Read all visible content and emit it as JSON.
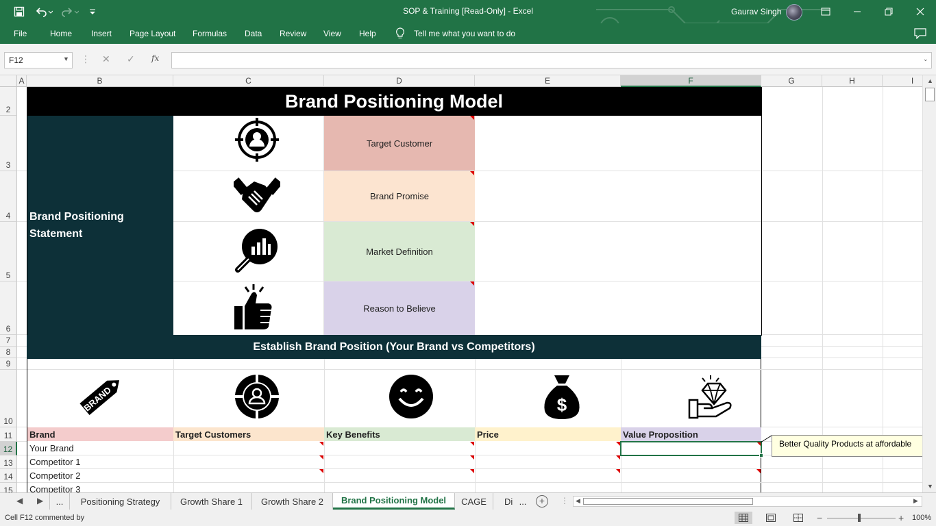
{
  "window": {
    "title": "SOP & Training  [Read-Only]  -  Excel",
    "user": "Gaurav Singh"
  },
  "ribbon": {
    "tabs": [
      "File",
      "Home",
      "Insert",
      "Page Layout",
      "Formulas",
      "Data",
      "Review",
      "View",
      "Help"
    ],
    "tell_me": "Tell me what you want to do"
  },
  "formula_bar": {
    "name_box": "F12",
    "fx": "fx",
    "formula": ""
  },
  "columns": [
    "A",
    "B",
    "C",
    "D",
    "E",
    "F",
    "G",
    "H",
    "I"
  ],
  "selected_column": "F",
  "rows": [
    "2",
    "3",
    "4",
    "5",
    "6",
    "7",
    "8",
    "9",
    "10",
    "11",
    "12",
    "13",
    "14",
    "15"
  ],
  "selected_row": "12",
  "sheet": {
    "title": "Brand Positioning Model",
    "statement_label": "Brand Positioning Statement",
    "elements": [
      "Target Customer",
      "Brand Promise",
      "Market Definition",
      "Reason to Believe"
    ],
    "establish_title": "Establish Brand Position (Your Brand vs Competitors)",
    "brand_icon_text": "BRAND",
    "table_headers": [
      "Brand",
      "Target Customers",
      "Key Benefits",
      "Price",
      "Value Proposition"
    ],
    "table_rows": [
      "Your Brand",
      "Competitor 1",
      "Competitor 2",
      "Competitor 3"
    ],
    "comment": "Better Quality Products at affordable",
    "colors": {
      "title_bg": "#000000",
      "teal": "#0d3038",
      "target_customer": "#e6b8b0",
      "brand_promise": "#fce4d0",
      "market_definition": "#d9ead3",
      "reason_to_believe": "#d9d2e9",
      "hdr_brand": "#f4cccc",
      "hdr_target": "#fce5cd",
      "hdr_benefits": "#d9ead3",
      "hdr_price": "#fff2cc",
      "hdr_value": "#d9d2e9",
      "excel_green": "#217346"
    }
  },
  "sheet_tabs": {
    "more_left": "...",
    "tabs": [
      "Positioning Strategy",
      "Growth Share 1",
      "Growth Share 2",
      "Brand Positioning Model",
      "CAGE",
      "Di"
    ],
    "more_right": "...",
    "active": "Brand Positioning Model"
  },
  "status": {
    "text": "Cell F12 commented by",
    "zoom": "100%"
  }
}
